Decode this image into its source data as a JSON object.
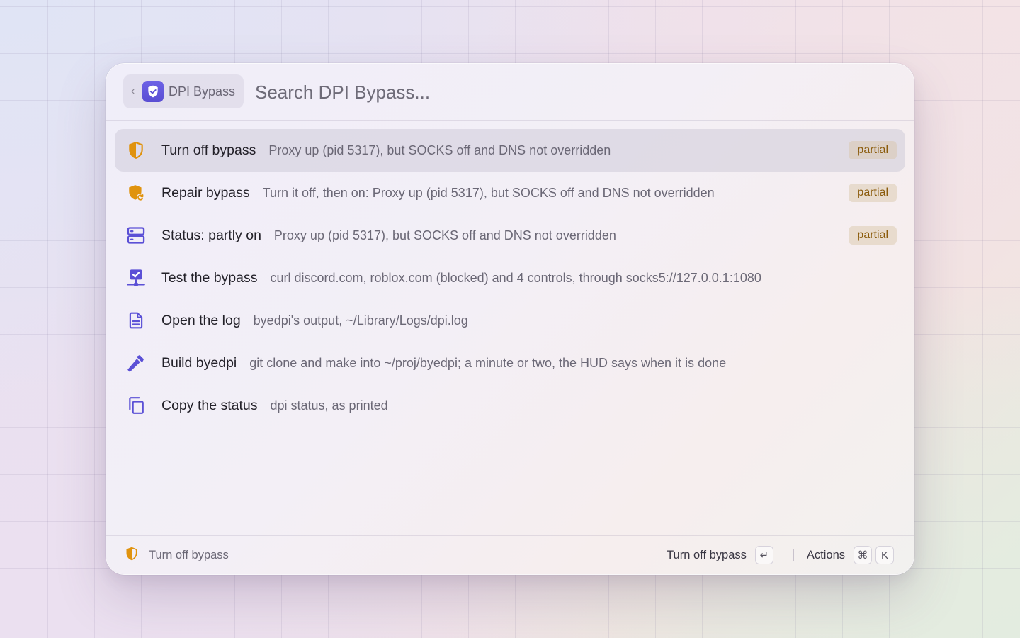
{
  "colors": {
    "accent": "#5b50d6",
    "warning": "#e0930e",
    "badge_text": "#8a5a0a"
  },
  "header": {
    "back": {
      "chevron": "‹",
      "icon": "shield-check-icon",
      "label": "DPI Bypass"
    },
    "search_placeholder": "Search DPI Bypass...",
    "search_value": ""
  },
  "items": [
    {
      "icon": "shield-half-icon",
      "title": "Turn off bypass",
      "subtitle": "Proxy up (pid 5317), but SOCKS off and DNS not overridden",
      "badge": "partial",
      "selected": true
    },
    {
      "icon": "shield-repair-icon",
      "title": "Repair bypass",
      "subtitle": "Turn it off, then on: Proxy up (pid 5317), but SOCKS off and DNS not overridden",
      "badge": "partial",
      "selected": false
    },
    {
      "icon": "server-icon",
      "title": "Status: partly on",
      "subtitle": "Proxy up (pid 5317), but SOCKS off and DNS not overridden",
      "badge": "partial",
      "selected": false
    },
    {
      "icon": "network-check-icon",
      "title": "Test the bypass",
      "subtitle": "curl discord.com, roblox.com (blocked) and 4 controls, through socks5://127.0.0.1:1080",
      "badge": "",
      "selected": false
    },
    {
      "icon": "document-icon",
      "title": "Open the log",
      "subtitle": "byedpi's output, ~/Library/Logs/dpi.log",
      "badge": "",
      "selected": false
    },
    {
      "icon": "hammer-icon",
      "title": "Build byedpi",
      "subtitle": "git clone and make into ~/proj/byedpi; a minute or two, the HUD says when it is done",
      "badge": "",
      "selected": false
    },
    {
      "icon": "copy-icon",
      "title": "Copy the status",
      "subtitle": "dpi status, as printed",
      "badge": "",
      "selected": false
    }
  ],
  "footer": {
    "left_icon": "shield-half-icon",
    "left_label": "Turn off bypass",
    "primary_action": "Turn off bypass",
    "primary_key": "↵",
    "actions_label": "Actions",
    "actions_keys": [
      "⌘",
      "K"
    ]
  }
}
